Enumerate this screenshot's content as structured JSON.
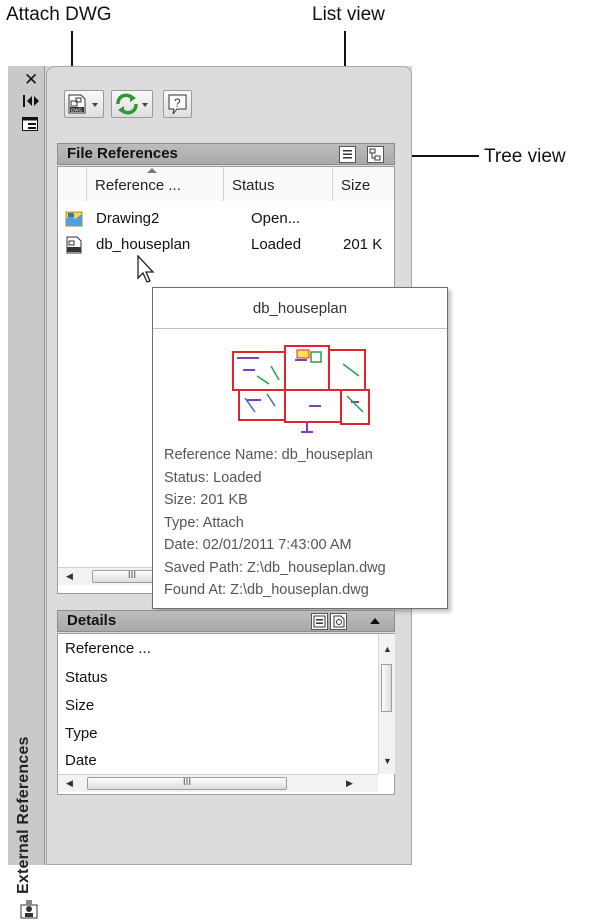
{
  "callouts": {
    "attach_dwg": "Attach DWG",
    "list_view": "List view",
    "tree_view": "Tree view"
  },
  "palette": {
    "vertical_title": "External References",
    "close_glyph": "✕",
    "autohide_glyph": "⇹"
  },
  "file_references": {
    "header": "File References",
    "columns": [
      "Reference ...",
      "Status",
      "Size"
    ],
    "rows": [
      {
        "name": "Drawing2",
        "status": "Open...",
        "size": ""
      },
      {
        "name": "db_houseplan",
        "status": "Loaded",
        "size": "201 K"
      }
    ],
    "scroll_mid": "III"
  },
  "tooltip": {
    "title": "db_houseplan",
    "lines": [
      "Reference Name: db_houseplan",
      "Status: Loaded",
      "Size: 201 KB",
      "Type: Attach",
      "Date: 02/01/2011 7:43:00 AM",
      "Saved Path: Z:\\db_houseplan.dwg",
      "Found At: Z:\\db_houseplan.dwg"
    ]
  },
  "details": {
    "header": "Details",
    "rows": [
      "Reference ...",
      "Status",
      "Size",
      "Type",
      "Date"
    ],
    "scroll_mid": "III"
  },
  "colors": {
    "panel_bg": "#dcdcdc",
    "header_bg": "#b3b3b3",
    "refresh_green": "#2f9a2f",
    "drawing_red": "#e0262b",
    "drawing_green": "#22a34a",
    "drawing_purple": "#7b3fbf"
  }
}
